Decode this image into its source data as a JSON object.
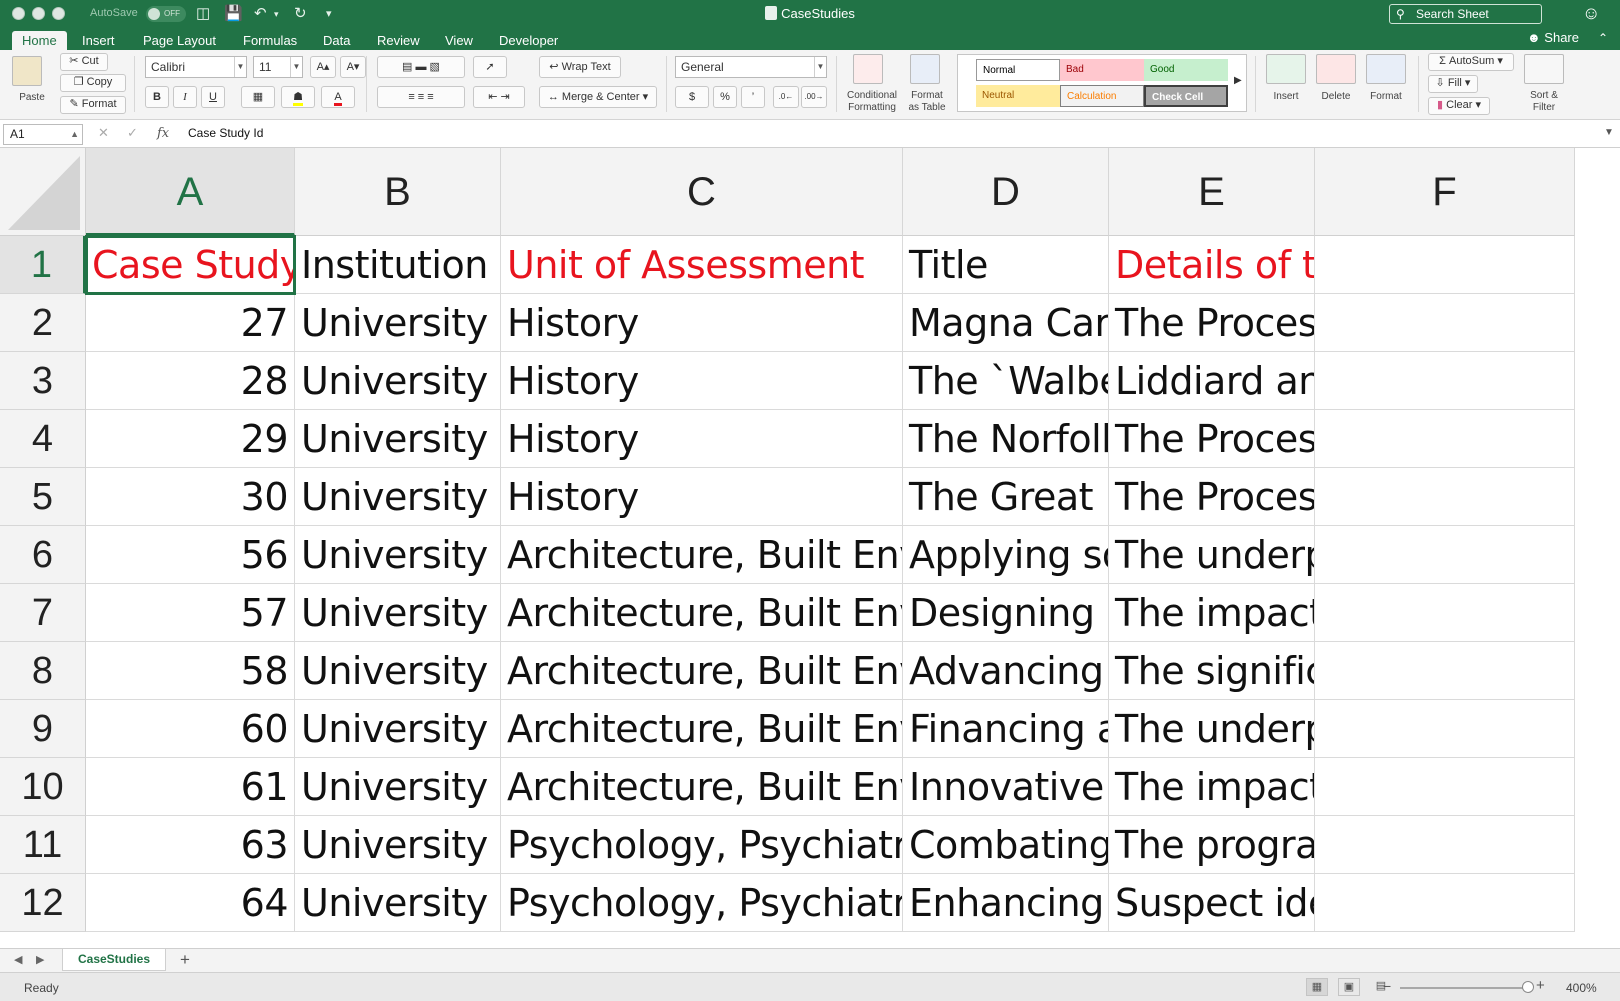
{
  "titlebar": {
    "autosave_label": "AutoSave",
    "autosave_state": "OFF",
    "document_title": "CaseStudies",
    "search_placeholder": "Search Sheet"
  },
  "ribbon_tabs": [
    "Home",
    "Insert",
    "Page Layout",
    "Formulas",
    "Data",
    "Review",
    "View",
    "Developer"
  ],
  "active_tab": "Home",
  "share_label": "Share",
  "clipboard": {
    "paste": "Paste",
    "cut": "Cut",
    "copy": "Copy",
    "format": "Format"
  },
  "font": {
    "name": "Calibri",
    "size": "11",
    "bold": "B",
    "italic": "I",
    "underline": "U"
  },
  "alignment": {
    "wrap_text": "Wrap Text",
    "merge_center": "Merge & Center"
  },
  "number": {
    "format": "General",
    "currency": "$",
    "percent": "%",
    "comma": "’"
  },
  "styles": {
    "conditional_formatting": [
      "Conditional",
      "Formatting"
    ],
    "format_as_table": [
      "Format",
      "as Table"
    ],
    "items": [
      {
        "label": "Normal",
        "bg": "#ffffff",
        "fg": "#333333"
      },
      {
        "label": "Bad",
        "bg": "#ffc7ce",
        "fg": "#9c0006"
      },
      {
        "label": "Good",
        "bg": "#c6efce",
        "fg": "#006100"
      },
      {
        "label": "Neutral",
        "bg": "#ffeb9c",
        "fg": "#9c5700"
      },
      {
        "label": "Calculation",
        "bg": "#f2f2f2",
        "fg": "#fa7d00"
      },
      {
        "label": "Check Cell",
        "bg": "#a5a5a5",
        "fg": "#ffffff"
      }
    ]
  },
  "cells_group": {
    "insert": "Insert",
    "delete": "Delete",
    "format": "Format"
  },
  "editing": {
    "autosum": "AutoSum",
    "fill": "Fill",
    "clear": "Clear",
    "sort_filter": [
      "Sort &",
      "Filter"
    ]
  },
  "formula_bar": {
    "name_box": "A1",
    "fx": "fx",
    "content": "Case Study Id"
  },
  "columns": [
    "A",
    "B",
    "C",
    "D",
    "E",
    "F"
  ],
  "rows": [
    {
      "num": "1",
      "cells": [
        "Case Study",
        "Institution",
        "Unit of Assessment",
        "Title",
        "Details of the impact",
        ""
      ]
    },
    {
      "num": "2",
      "cells": [
        "27",
        "University o",
        "History",
        "Magna Cart",
        "The Process and Beneficiar",
        ""
      ]
    },
    {
      "num": "3",
      "cells": [
        "28",
        "University o",
        "History",
        "The `Walbe",
        "Liddiard and Sims' researc",
        ""
      ]
    },
    {
      "num": "4",
      "cells": [
        "29",
        "University o",
        "History",
        "The Norfolk",
        "The Process: The project be",
        ""
      ]
    },
    {
      "num": "5",
      "cells": [
        "30",
        "University o",
        "History",
        "The Great H",
        "The Process: Rawcliffe, the",
        ""
      ]
    },
    {
      "num": "6",
      "cells": [
        "56",
        "University o",
        "Architecture, Built Envi",
        "Applying so",
        "The underpinning research",
        ""
      ]
    },
    {
      "num": "7",
      "cells": [
        "57",
        "University o",
        "Architecture, Built Envi",
        "Designing N",
        "The impact of the underpin",
        ""
      ]
    },
    {
      "num": "8",
      "cells": [
        "58",
        "University o",
        "Architecture, Built Envi",
        "Advancing S",
        "The significance of the und",
        ""
      ]
    },
    {
      "num": "9",
      "cells": [
        "60",
        "University o",
        "Architecture, Built Envi",
        "Financing an",
        "The underpinning research",
        ""
      ]
    },
    {
      "num": "10",
      "cells": [
        "61",
        "University o",
        "Architecture, Built Envi",
        "Innovative S",
        "The impact of the underpin",
        ""
      ]
    },
    {
      "num": "11",
      "cells": [
        "63",
        "University o",
        "Psychology, Psychiatry",
        "Combating",
        "The programme of research",
        ""
      ]
    },
    {
      "num": "12",
      "cells": [
        "64",
        "University o",
        "Psychology, Psychiatry",
        "Enhancing S",
        "Suspect identification from",
        ""
      ]
    }
  ],
  "header_red_columns": [
    "A",
    "C",
    "E"
  ],
  "accent_color": "#217346",
  "header_red_color": "#e8141e",
  "sheet_tabs": [
    "CaseStudies"
  ],
  "status": {
    "text": "Ready",
    "zoom": "400%"
  }
}
